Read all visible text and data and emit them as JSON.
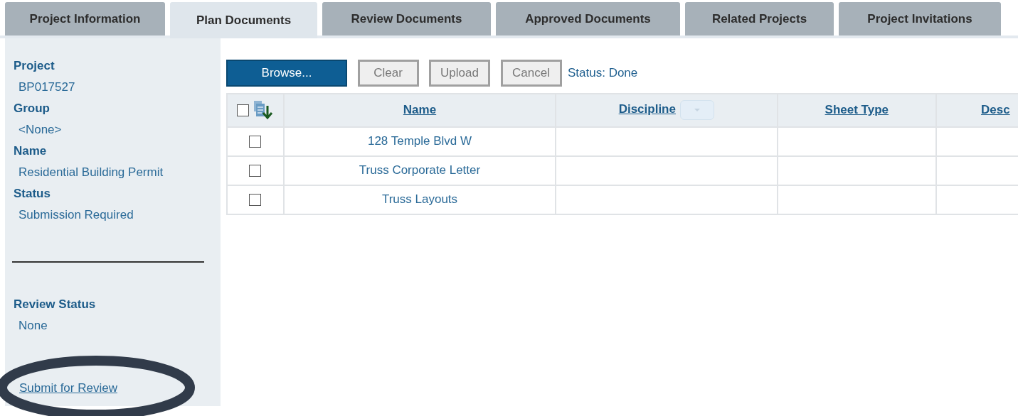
{
  "tabs": [
    {
      "label": "Project Information",
      "selected": false
    },
    {
      "label": "Plan Documents",
      "selected": true
    },
    {
      "label": "Review Documents",
      "selected": false
    },
    {
      "label": "Approved Documents",
      "selected": false
    },
    {
      "label": "Related Projects",
      "selected": false
    },
    {
      "label": "Project Invitations",
      "selected": false
    }
  ],
  "sidebar": {
    "fields": [
      {
        "label": "Project",
        "value": "BP017527"
      },
      {
        "label": "Group",
        "value": "<None>"
      },
      {
        "label": "Name",
        "value": "Residential Building Permit"
      },
      {
        "label": "Status",
        "value": "Submission Required"
      }
    ],
    "review": {
      "label": "Review Status",
      "value": "None"
    },
    "action_link": "Submit for Review"
  },
  "toolbar": {
    "buttons": [
      {
        "label": "Browse...",
        "kind": "primary"
      },
      {
        "label": "Clear",
        "kind": "plain"
      },
      {
        "label": "Upload",
        "kind": "plain"
      },
      {
        "label": "Cancel",
        "kind": "plain"
      }
    ],
    "status": "Status: Done"
  },
  "table": {
    "select_all": {
      "checked": false
    },
    "columns": [
      {
        "label": "Name",
        "filter": false
      },
      {
        "label": "Discipline",
        "filter": true
      },
      {
        "label": "Sheet Type",
        "filter": false
      },
      {
        "label": "Desc",
        "filter": false
      }
    ],
    "rows": [
      {
        "checked": false,
        "name": "128 Temple Blvd W"
      },
      {
        "checked": false,
        "name": "Truss Corporate Letter"
      },
      {
        "checked": false,
        "name": "Truss Layouts"
      }
    ]
  }
}
